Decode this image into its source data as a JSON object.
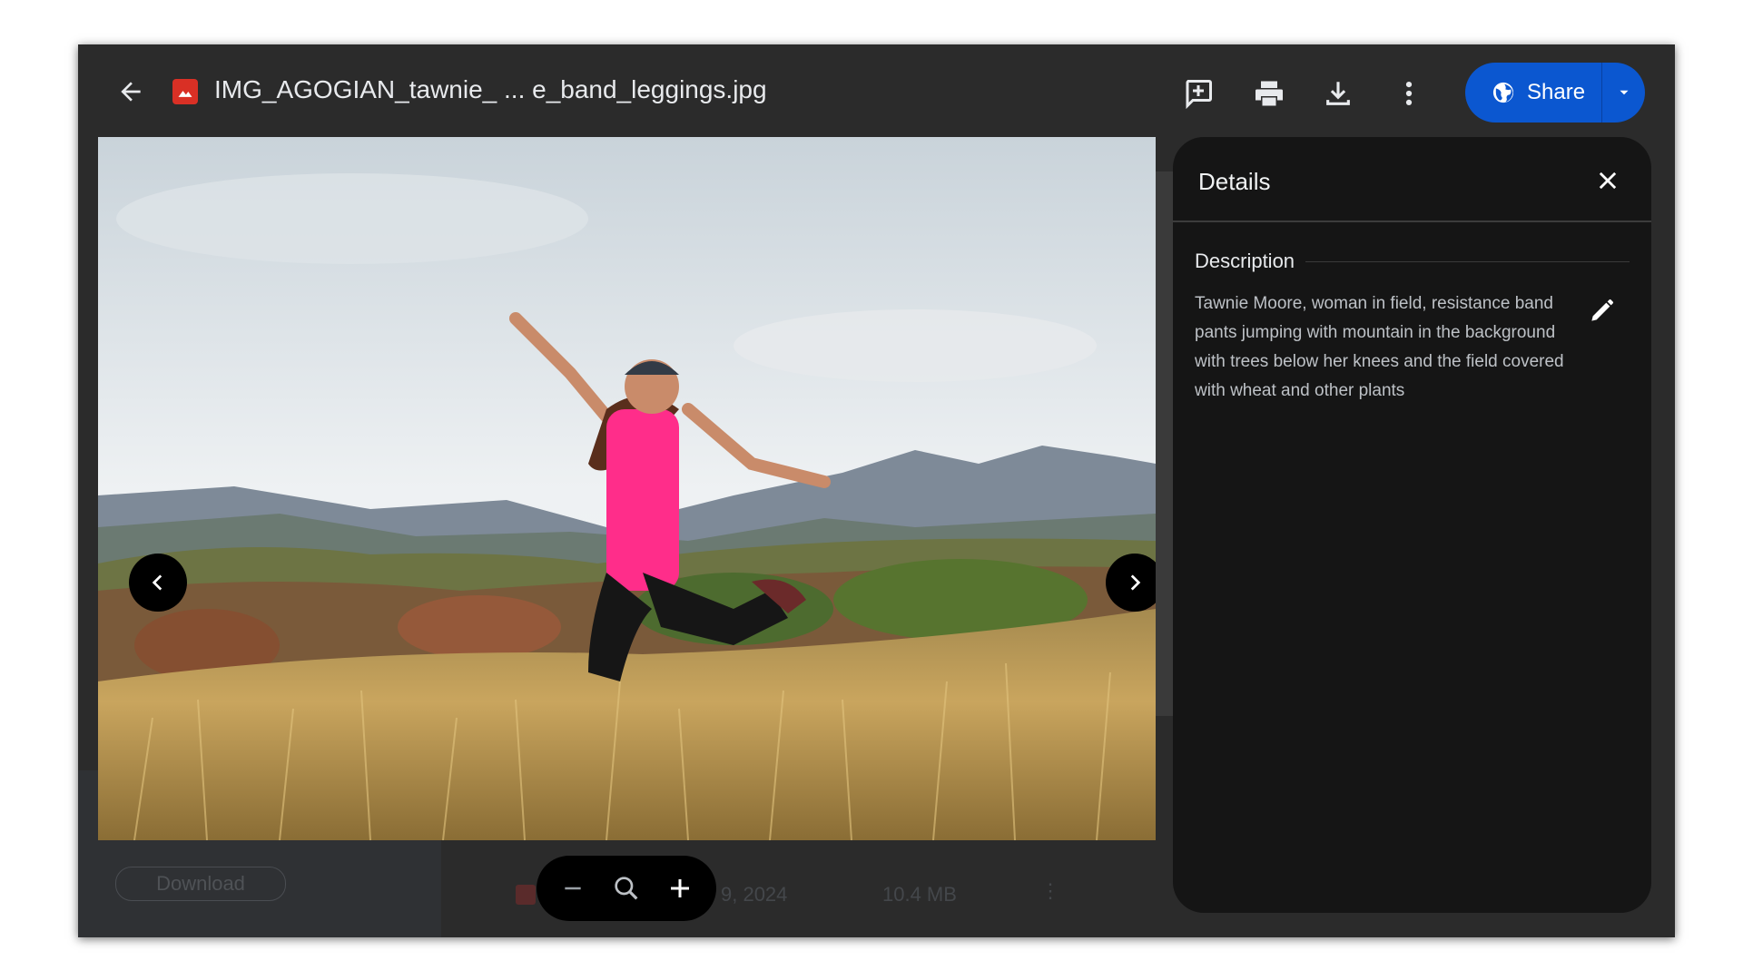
{
  "viewer": {
    "file_name": "IMG_AGOGIAN_tawnie_ ... e_band_leggings.jpg",
    "share_label": "Share",
    "toolbar_icons": [
      "add-comment-icon",
      "print-icon",
      "download-icon",
      "more-vert-icon"
    ]
  },
  "background": {
    "download_label": "Download",
    "date_fragment": "9, 2024",
    "size": "10.4 MB"
  },
  "details": {
    "title": "Details",
    "section_title": "Description",
    "description": "Tawnie Moore, woman in field, resistance band pants jumping with mountain in the background with trees below her knees and the field covered with wheat and other plants"
  },
  "colors": {
    "window_bg": "#2b2b2b",
    "panel_bg": "#151515",
    "share_blue": "#0b57d0",
    "file_icon_red": "#d93025",
    "shirt_pink": "#ff2d8a"
  }
}
